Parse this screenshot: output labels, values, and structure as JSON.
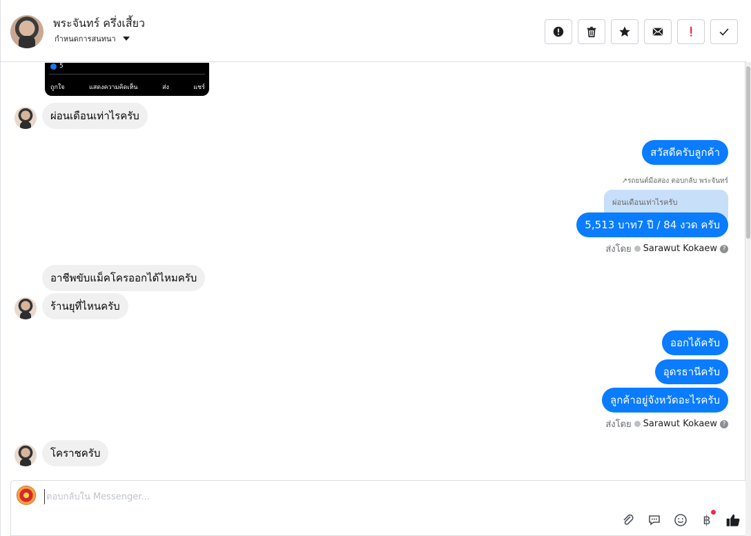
{
  "header": {
    "contact_name": "พระจันทร์ ครึ่งเสี้ยว",
    "assign_label": "กำหนดการสนทนา",
    "actions": [
      {
        "name": "spam-button",
        "icon": "alert-circle-icon"
      },
      {
        "name": "delete-button",
        "icon": "trash-icon"
      },
      {
        "name": "star-button",
        "icon": "star-icon"
      },
      {
        "name": "mark-unread-button",
        "icon": "envelope-icon"
      },
      {
        "name": "flag-important-button",
        "icon": "exclamation-icon"
      },
      {
        "name": "mark-done-button",
        "icon": "check-icon"
      }
    ]
  },
  "preview_card": {
    "like_count": "5",
    "actions": [
      "ถูกใจ",
      "แสดงความคิดเห็น",
      "ส่ง",
      "แชร์"
    ]
  },
  "messages": {
    "in_1": "ผ่อนเดือนเท่าไรครับ",
    "out_1": "สวัสดีครับลูกค้า",
    "reply_meta": "รถยนต์มือสอง ตอบกลับ พระจันทร์",
    "quote_text": "ผ่อนเดือนเท่าไรครับ",
    "out_2": "5,513 บาท7 ปี / 84 งวด ครับ",
    "sent_by_label": "ส่งโดย",
    "agent_name": "Sarawut Kokaew",
    "in_2": "อาชีพขับแม็คโครออกได้ไหมครับ",
    "in_3": "ร้านยุที่ไหนครับ",
    "out_3": "ออกได้ครับ",
    "out_4": "อุดรธานีครับ",
    "out_5": "ลูกค้าอยู่จังหวัดอะไรครับ",
    "in_4": "โคราชครับ"
  },
  "composer": {
    "placeholder": "ตอบกลับใน Messenger...",
    "baht_symbol": "฿"
  },
  "colors": {
    "outgoing_bubble": "#0a7cff",
    "incoming_bubble": "#f0f0f0",
    "quote_bubble": "#c7dff9",
    "notify_dot": "#f0284a"
  }
}
